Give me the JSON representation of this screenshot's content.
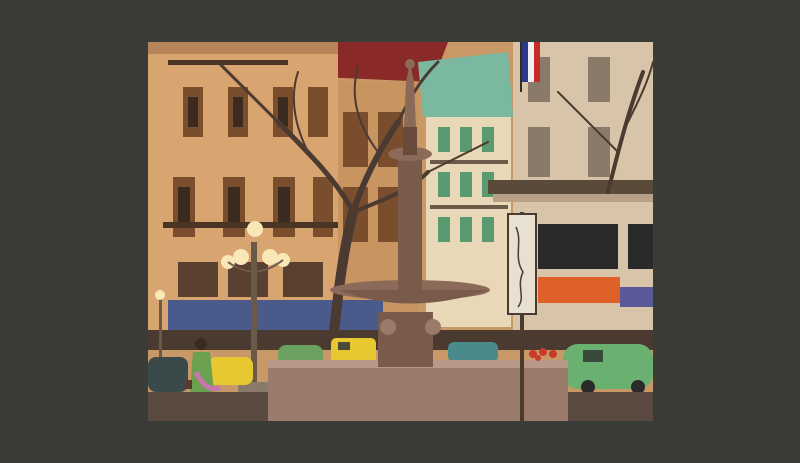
{
  "page": {
    "background_color": "#3a3c38"
  },
  "artwork": {
    "subject": "illustrated-city-square-fountain",
    "palette": {
      "sky_building_left": "#d4a070",
      "building_right": "#d8c8b0",
      "green_building": "#7ab8a0",
      "red_roof": "#8a2a28",
      "awning_blue": "#4a5a8a",
      "awning_orange": "#e0602a",
      "fountain": "#8c6a5a",
      "tree": "#4a3a30",
      "car_yellow": "#e8c830",
      "car_green": "#6ab070",
      "ground": "#5a4a40"
    }
  }
}
